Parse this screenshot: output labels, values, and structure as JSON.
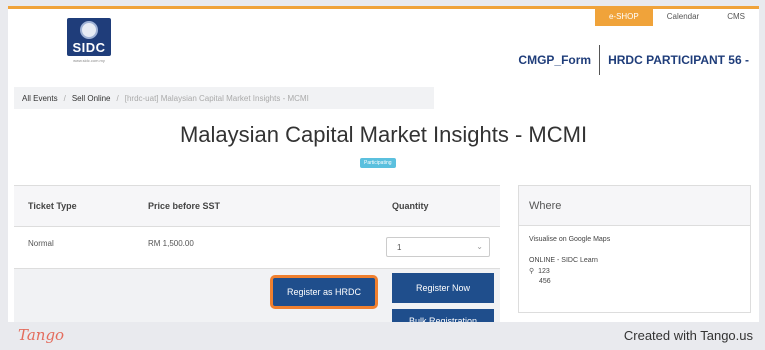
{
  "header": {
    "logo_text": "SIDC",
    "logo_sub": "www.sidc.com.my",
    "nav": [
      "e-SHOP",
      "Calendar",
      "CMS"
    ],
    "form_link": "CMGP_Form",
    "user_name": "HRDC PARTICIPANT 56 -"
  },
  "breadcrumb": {
    "items": [
      "All Events",
      "Sell Online",
      "[hrdc-uat] Malaysian Capital Market Insights - MCMI"
    ]
  },
  "event": {
    "title": "Malaysian Capital Market Insights - MCMI",
    "badge": "Participating"
  },
  "tickets": {
    "headers": [
      "Ticket Type",
      "Price before SST",
      "Quantity"
    ],
    "rows": [
      {
        "type": "Normal",
        "price": "RM 1,500.00",
        "quantity": "1"
      }
    ],
    "buttons": {
      "register_hrdc": "Register as HRDC",
      "register_now": "Register Now",
      "bulk": "Bulk Registration"
    }
  },
  "where": {
    "heading": "Where",
    "maps_link": "Visualise on Google Maps",
    "location": "ONLINE - SIDC Learn",
    "address_line1": "123",
    "address_line2": "456"
  },
  "footer": {
    "logo": "Tango",
    "credit": "Created with Tango.us"
  },
  "colors": {
    "accent": "#f0a33a",
    "primary": "#1f4e8c",
    "highlight": "#f0802f"
  }
}
